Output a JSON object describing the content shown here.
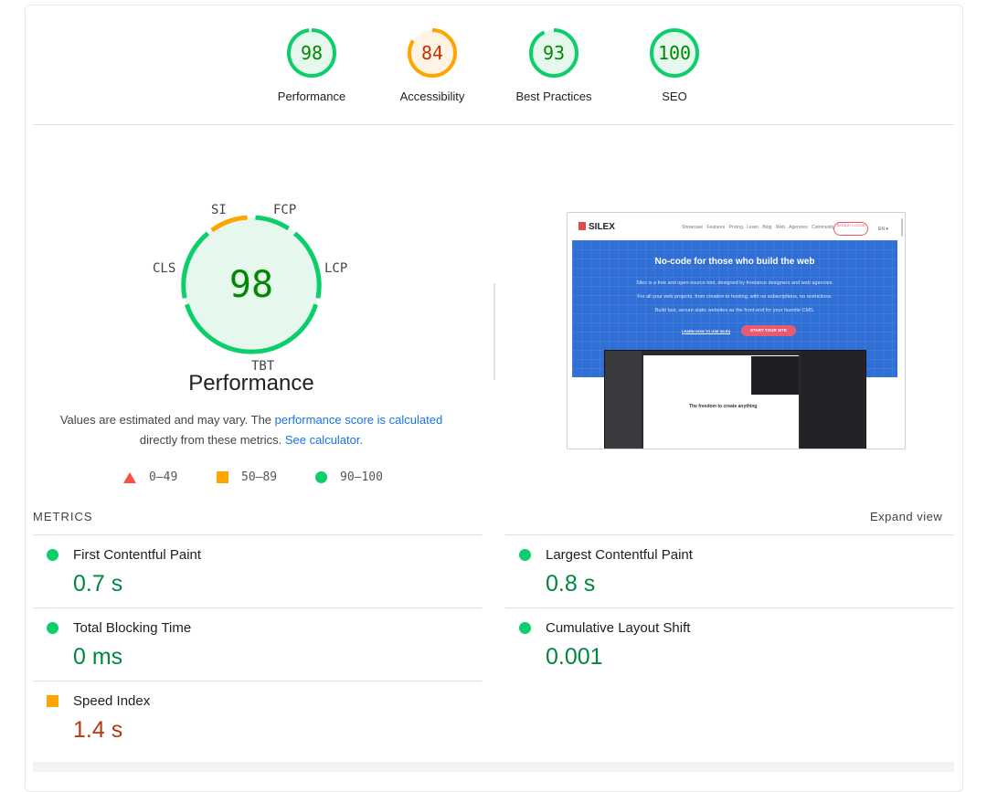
{
  "colors": {
    "pass": "#0cce6b",
    "average": "#ffa400",
    "fail": "#ff4e42",
    "link": "#1a73e8"
  },
  "summary": [
    {
      "label": "Performance",
      "score": "98",
      "fraction": 0.98,
      "status": "pass"
    },
    {
      "label": "Accessibility",
      "score": "84",
      "fraction": 0.84,
      "status": "average"
    },
    {
      "label": "Best Practices",
      "score": "93",
      "fraction": 0.93,
      "status": "pass"
    },
    {
      "label": "SEO",
      "score": "100",
      "fraction": 1.0,
      "status": "pass"
    }
  ],
  "performance": {
    "score": "98",
    "title": "Performance",
    "axis": {
      "si": "SI",
      "fcp": "FCP",
      "lcp": "LCP",
      "tbt": "TBT",
      "cls": "CLS"
    },
    "note": {
      "before": "Values are estimated and may vary. The ",
      "link1": "performance score is calculated",
      "middle": " directly from these metrics. ",
      "link2": "See calculator."
    },
    "legend": [
      {
        "shape": "triangle",
        "range": "0–49"
      },
      {
        "shape": "square",
        "range": "50–89"
      },
      {
        "shape": "circle",
        "range": "90–100"
      }
    ]
  },
  "screenshot": {
    "logo": "SILEX",
    "nav": "Showcase Features Pricing Learn Blog Web Agencies Community",
    "signup": "SIGNUP / LOGIN",
    "lang": "EN ▾",
    "hero_title": "No-code for those who build the web",
    "hero_lines": [
      "Silex is a free and open-source tool, designed by freelance designers and web agencies.",
      "For all your web projects, from creation to hosting, with no subscriptions, no restrictions.",
      "Build fast, secure static websites as the front-end for your favorite CMS."
    ],
    "learn_btn": "LEARN HOW TO USE SILEX",
    "start_btn": "START YOUR SITE",
    "canvas_text": "The freedom to create anything"
  },
  "metrics": {
    "title": "METRICS",
    "expand": "Expand view",
    "items": [
      {
        "name": "First Contentful Paint",
        "value": "0.7 s",
        "status": "pass"
      },
      {
        "name": "Largest Contentful Paint",
        "value": "0.8 s",
        "status": "pass"
      },
      {
        "name": "Total Blocking Time",
        "value": "0 ms",
        "status": "pass"
      },
      {
        "name": "Cumulative Layout Shift",
        "value": "0.001",
        "status": "pass"
      },
      {
        "name": "Speed Index",
        "value": "1.4 s",
        "status": "average"
      }
    ]
  }
}
